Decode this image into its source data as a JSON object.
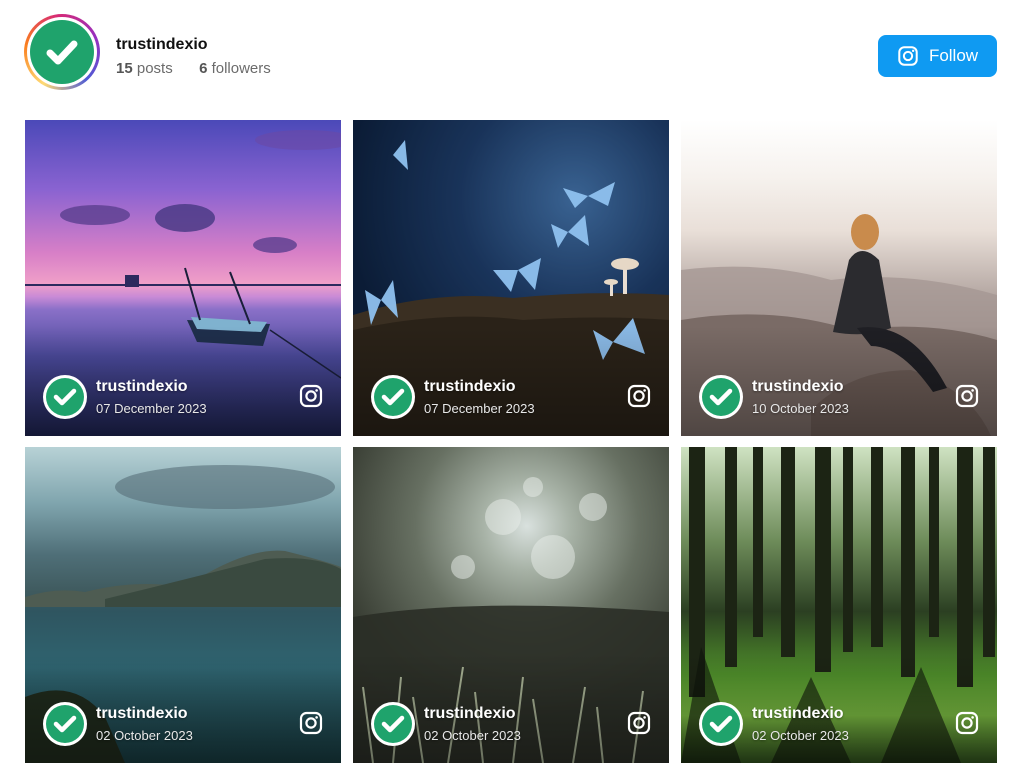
{
  "profile": {
    "username": "trustindexio",
    "posts_count": "15",
    "posts_label": "posts",
    "followers_count": "6",
    "followers_label": "followers",
    "follow_label": "Follow"
  },
  "colors": {
    "follow_button": "#0f9af2",
    "badge_green": "#1fa36c"
  },
  "posts": [
    {
      "username": "trustindexio",
      "date": "07 December 2023",
      "scene": "boat on pink sunset lake"
    },
    {
      "username": "trustindexio",
      "date": "07 December 2023",
      "scene": "blue butterflies and mushrooms"
    },
    {
      "username": "trustindexio",
      "date": "10 October 2023",
      "scene": "woman sitting on rock over valley"
    },
    {
      "username": "trustindexio",
      "date": "02 October 2023",
      "scene": "mountains over sea at dusk"
    },
    {
      "username": "trustindexio",
      "date": "02 October 2023",
      "scene": "blurred grass and trees"
    },
    {
      "username": "trustindexio",
      "date": "02 October 2023",
      "scene": "sunlit pine forest"
    }
  ]
}
